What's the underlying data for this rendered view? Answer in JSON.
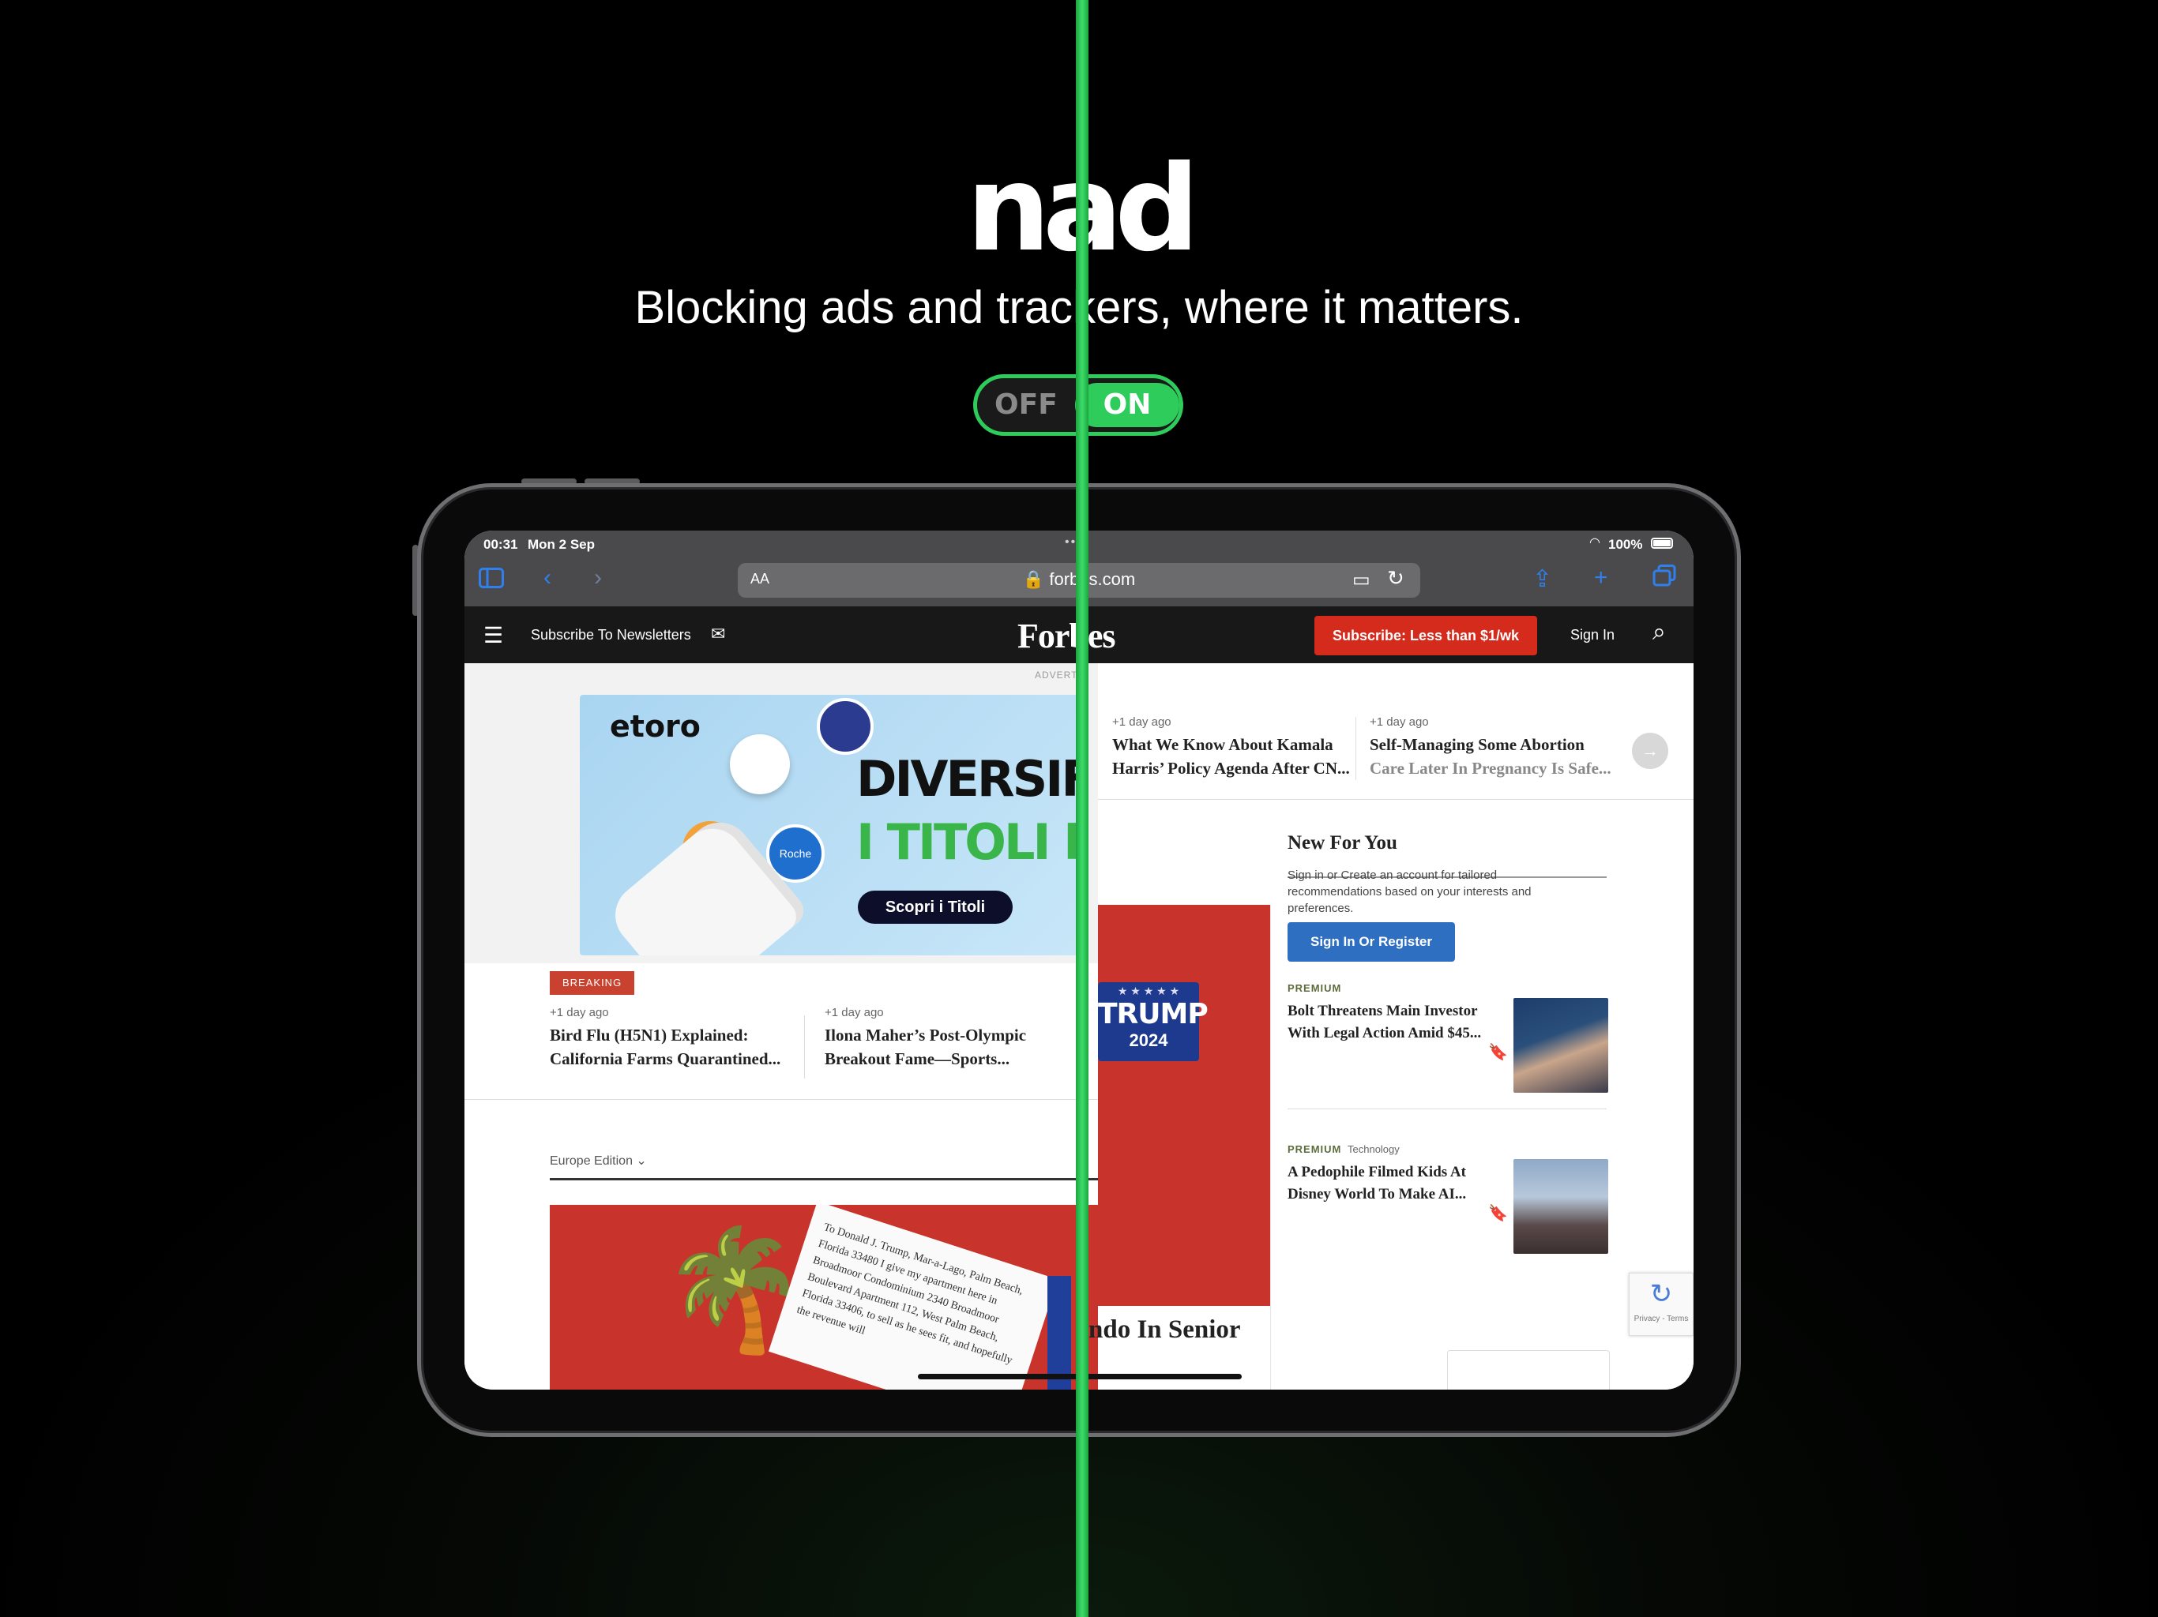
{
  "hero": {
    "brand": "nad",
    "tagline": "Blocking ads and trackers, where it matters.",
    "toggle_off": "OFF",
    "toggle_on": "ON"
  },
  "colors": {
    "accent_green": "#2ecc5a",
    "forbes_red": "#d42b1c",
    "link_blue": "#2f6fc2",
    "safari_blue": "#2f80ed"
  },
  "status_bar": {
    "time": "00:31",
    "date": "Mon 2 Sep",
    "battery": "100%",
    "icons": [
      "wifi-icon",
      "battery-icon"
    ]
  },
  "safari": {
    "text_size": "AA",
    "url": "forbes.com",
    "icons": [
      "sidebar-icon",
      "back-icon",
      "forward-icon",
      "lock-icon",
      "reader-icon",
      "reload-icon",
      "share-icon",
      "new-tab-icon",
      "tabs-icon"
    ]
  },
  "forbes_nav": {
    "subscribe_newsletters": "Subscribe To Newsletters",
    "logo": "Forbes",
    "cta": "Subscribe: Less than $1/wk",
    "sign_in": "Sign In"
  },
  "ad": {
    "label": "ADVERT",
    "brand": "etoro",
    "line1": "DIVERSIFICA",
    "line2": "I TITOLI FARM",
    "cta": "Scopri i Titoli",
    "coin_label": "Roche"
  },
  "ticker_left": {
    "badge": "BREAKING",
    "items": [
      {
        "ago": "+1 day ago",
        "title1": "Bird Flu (H5N1) Explained:",
        "title2": "California Farms Quarantined..."
      },
      {
        "ago": "+1 day ago",
        "title1": "Ilona Maher’s Post-Olympic",
        "title2": "Breakout Fame—Sports..."
      }
    ]
  },
  "ticker_right": {
    "items": [
      {
        "ago": "+1 day ago",
        "title1": "What We Know About Kamala",
        "title2": "Harris’ Policy Agenda After CN..."
      },
      {
        "ago": "+1 day ago",
        "title1": "Self-Managing Some Abortion",
        "title2": "Care Later In Pregnancy Is Safe..."
      }
    ]
  },
  "edition": {
    "label": "Europe Edition"
  },
  "letter_text": "To Donald J. Trump, Mar-a-Lago, Palm Beach, Florida 33480 I give my apartment here in Broadmoor Condominium 2340 Broadmoor Boulevard Apartment 112, West Palm Beach, Florida 33406, to sell as he sees fit, and hopefully the revenue will",
  "trump_sign": {
    "line1": "TRUMP",
    "line2": "2024"
  },
  "article_headline_fragment": "ndo In Senior",
  "new_for_you": {
    "title": "New For You",
    "text": "Sign in or Create an account for tailored recommendations based on your interests and preferences.",
    "button": "Sign In Or Register",
    "items": [
      {
        "badge": "PREMIUM",
        "tag": "",
        "title1": "Bolt Threatens Main Investor",
        "title2": "With Legal Action Amid $45..."
      },
      {
        "badge": "PREMIUM",
        "tag": "Technology",
        "title1": "A Pedophile Filmed Kids At",
        "title2": "Disney World To Make AI..."
      }
    ]
  },
  "recaptcha": {
    "text": "Privacy - Terms"
  }
}
